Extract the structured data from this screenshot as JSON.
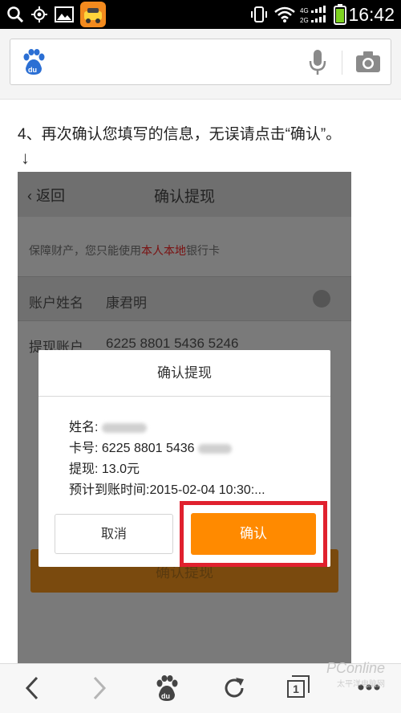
{
  "status_bar": {
    "time": "16:42",
    "left_icons": [
      "search-icon",
      "gps-icon",
      "image-icon",
      "taxi-app-icon"
    ],
    "right_icons": [
      "vibrate-icon",
      "wifi-icon",
      "signal-4g-2g-icon",
      "battery-icon"
    ]
  },
  "search_bar": {
    "placeholder": "",
    "icons": [
      "baidu-du-icon",
      "mic-icon",
      "camera-icon"
    ]
  },
  "article": {
    "step_text": "4、再次确认您填写的信息，无误请点击“确认”。",
    "arrow": "↓"
  },
  "embedded_screen": {
    "back_label": "返回",
    "title": "确认提现",
    "notice_prefix": "保障财产，您只能使用",
    "notice_highlight": "本人本地",
    "notice_suffix": "银行卡",
    "account_name_label": "账户姓名",
    "account_name_value": "康君明",
    "account_label": "提现账户",
    "account_value": "6225 8801 5436 5246",
    "background_button": "确认提现"
  },
  "dialog": {
    "title": "确认提现",
    "name_label": "姓名:",
    "card_label": "卡号:",
    "card_visible": "6225 8801 5436",
    "amount_label": "提现:",
    "amount_value": "13.0元",
    "eta_label": "预计到账时间:",
    "eta_value": "2015-02-04 10:30:...",
    "cancel_label": "取消",
    "confirm_label": "确认"
  },
  "bottom_nav": {
    "icons": [
      "back-icon",
      "forward-icon",
      "baidu-home-icon",
      "refresh-icon",
      "tabs-icon",
      "menu-icon"
    ],
    "tab_count": "1"
  },
  "watermark": {
    "brand": "PConline",
    "sub": "太平洋电脑网"
  },
  "colors": {
    "accent_orange": "#ff8a00",
    "highlight_red": "#e0212e",
    "overlay_gray": "#7a7a7a"
  }
}
